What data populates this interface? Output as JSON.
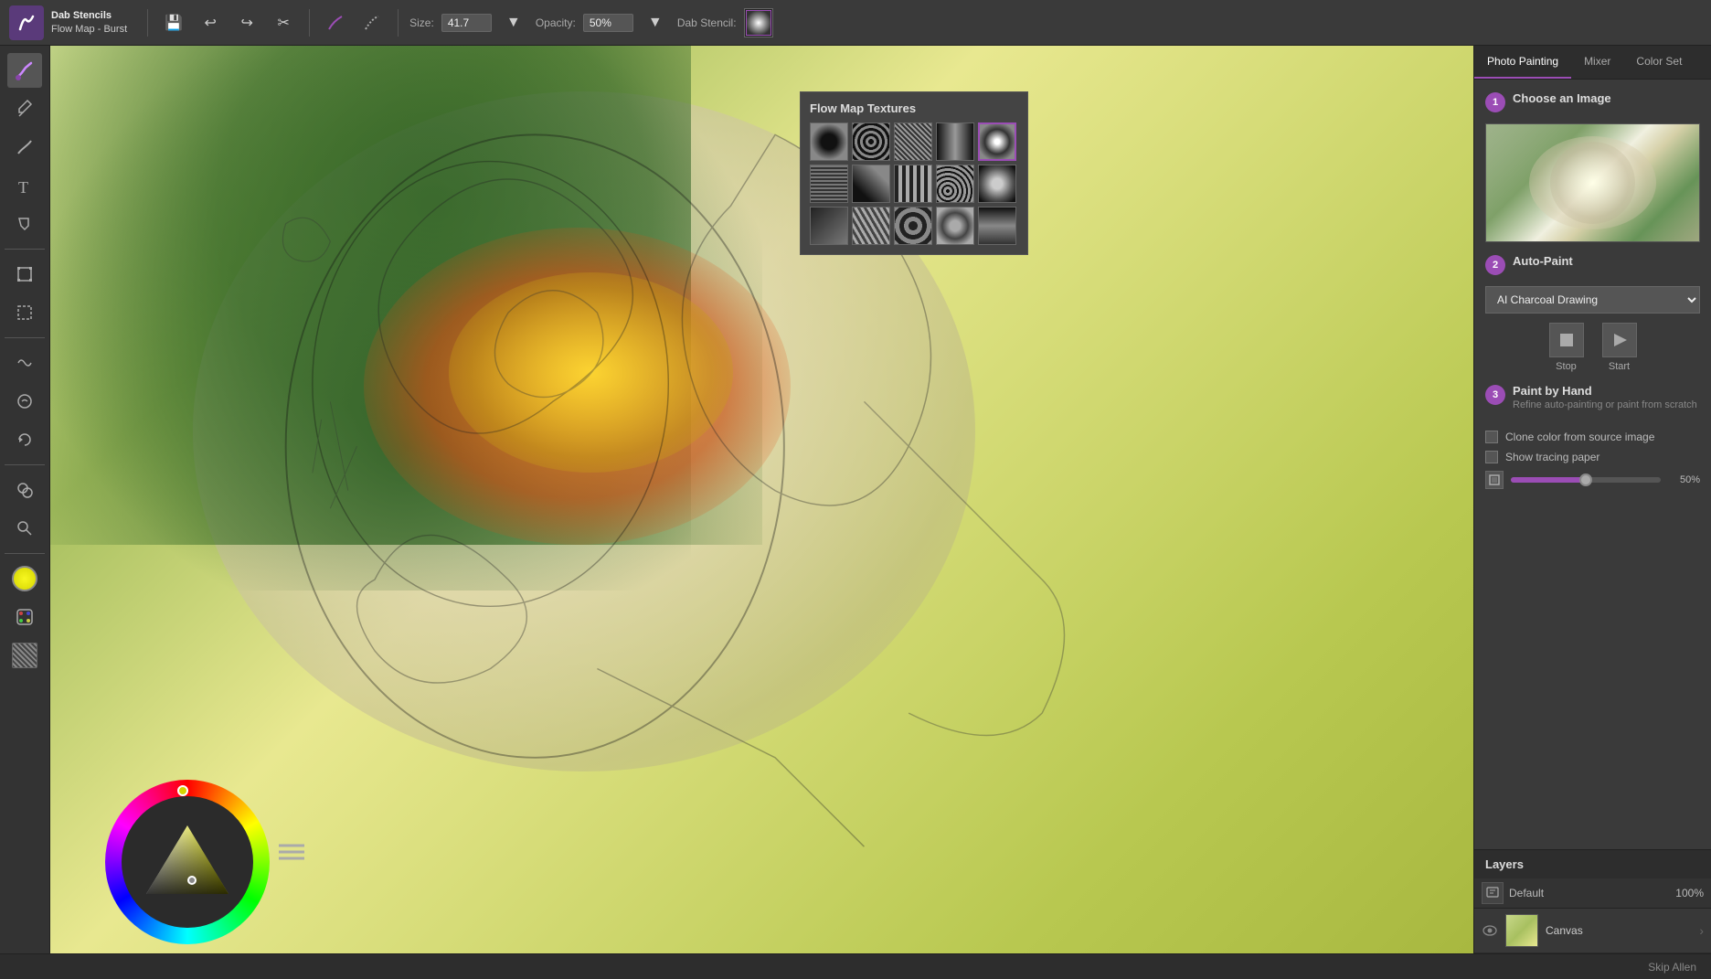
{
  "toolbar": {
    "app_name": "Dab Stencils",
    "app_subtitle": "Flow Map - Burst",
    "size_label": "Size:",
    "size_value": "41.7",
    "opacity_label": "Opacity:",
    "opacity_value": "50%",
    "dab_stencil_label": "Dab Stencil:"
  },
  "flow_map_popup": {
    "title": "Flow Map Textures",
    "textures_count": 15
  },
  "right_panel": {
    "tabs": [
      {
        "id": "photo-painting",
        "label": "Photo Painting",
        "active": true
      },
      {
        "id": "mixer",
        "label": "Mixer",
        "active": false
      },
      {
        "id": "color-set",
        "label": "Color Set",
        "active": false
      }
    ],
    "step1": {
      "number": "1",
      "label": "Choose an Image"
    },
    "step2": {
      "number": "2",
      "label": "Auto-Paint",
      "dropdown_value": "AI Charcoal Drawing",
      "stop_label": "Stop",
      "start_label": "Start"
    },
    "step3": {
      "number": "3",
      "label": "Paint by Hand",
      "subtitle": "Refine auto-painting or paint from scratch",
      "clone_label": "Clone color from source image",
      "tracing_label": "Show tracing paper",
      "opacity_value": "50%"
    }
  },
  "layers": {
    "title": "Layers",
    "default_label": "Default",
    "opacity_value": "100%",
    "canvas_layer": "Canvas"
  },
  "footer": {
    "author": "Skip Allen"
  }
}
